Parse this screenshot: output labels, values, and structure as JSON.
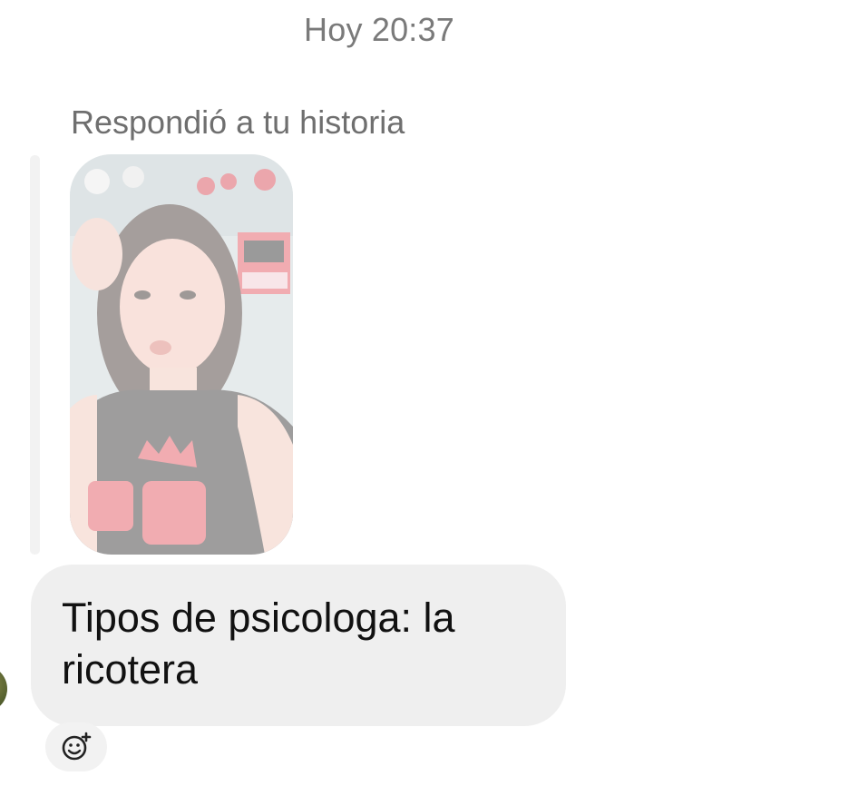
{
  "thread": {
    "timestamp": "Hoy 20:37",
    "reply_label": "Respondió a tu historia",
    "story_thumbnail_icon": "story-photo-icon",
    "message": {
      "text": "Tipos de psicologa: la ricotera"
    },
    "reaction_icon": "add-reaction-icon"
  },
  "colors": {
    "bubble_background": "#efefef",
    "timestamp_text": "#7a7a7a",
    "reply_bar": "#f2f2f2"
  }
}
